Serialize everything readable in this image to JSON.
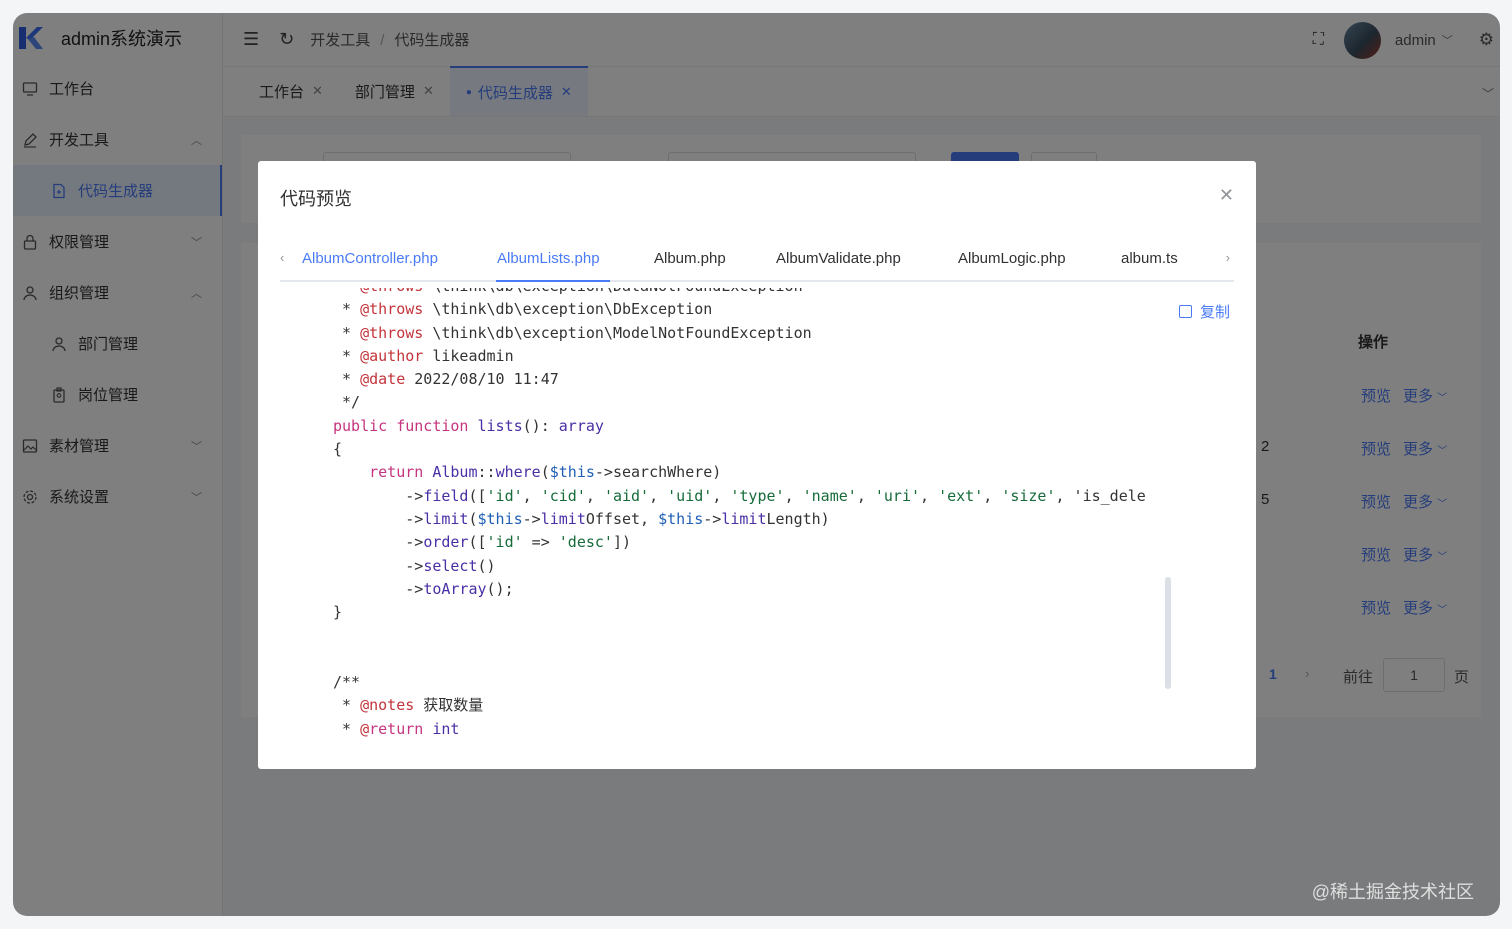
{
  "app": {
    "title": "admin系统演示"
  },
  "sidebar": {
    "items": [
      {
        "label": "工作台",
        "icon": "monitor-icon"
      },
      {
        "label": "开发工具",
        "icon": "pen-icon",
        "expanded": true
      },
      {
        "label": "代码生成器",
        "icon": "file-code-icon",
        "active": true
      },
      {
        "label": "权限管理",
        "icon": "lock-icon"
      },
      {
        "label": "组织管理",
        "icon": "user-icon",
        "expanded": true
      },
      {
        "label": "部门管理",
        "icon": "user-icon"
      },
      {
        "label": "岗位管理",
        "icon": "badge-icon"
      },
      {
        "label": "素材管理",
        "icon": "image-icon"
      },
      {
        "label": "系统设置",
        "icon": "gear-icon"
      }
    ]
  },
  "header": {
    "breadcrumb": [
      "开发工具",
      "代码生成器"
    ],
    "username": "admin"
  },
  "tabs": [
    {
      "label": "工作台"
    },
    {
      "label": "部门管理"
    },
    {
      "label": "代码生成器",
      "active": true
    }
  ],
  "background_table": {
    "operation_header": "操作",
    "preview_label": "预览",
    "more_label": "更多",
    "partial_ids": [
      "",
      "2",
      "5",
      "",
      ""
    ],
    "pagination": {
      "current": "1",
      "goto_label": "前往",
      "goto_value": "1",
      "page_suffix": "页"
    }
  },
  "dialog": {
    "title": "代码预览",
    "copy_label": "复制",
    "file_tabs": [
      "AlbumController.php",
      "AlbumLists.php",
      "Album.php",
      "AlbumValidate.php",
      "AlbumLogic.php",
      "album.ts"
    ],
    "active_file": "AlbumLists.php",
    "code_lines": [
      " * @throws \\think\\db\\exception\\DataNotFoundException",
      " * @throws \\think\\db\\exception\\DbException",
      " * @throws \\think\\db\\exception\\ModelNotFoundException",
      " * @author likeadmin",
      " * @date 2022/08/10 11:47",
      " */",
      "public function lists(): array",
      "{",
      "    return Album::where($this->searchWhere)",
      "        ->field(['id', 'cid', 'aid', 'uid', 'type', 'name', 'uri', 'ext', 'size', 'is_dele",
      "        ->limit($this->limitOffset, $this->limitLength)",
      "        ->order(['id' => 'desc'])",
      "        ->select()",
      "        ->toArray();",
      "}",
      "",
      "",
      "/**",
      " * @notes 获取数量",
      " * @return int"
    ]
  },
  "watermark": "@稀土掘金技术社区",
  "colors": {
    "accent": "#4a7bf7",
    "overlay": "rgba(0,0,0,0.5)"
  }
}
